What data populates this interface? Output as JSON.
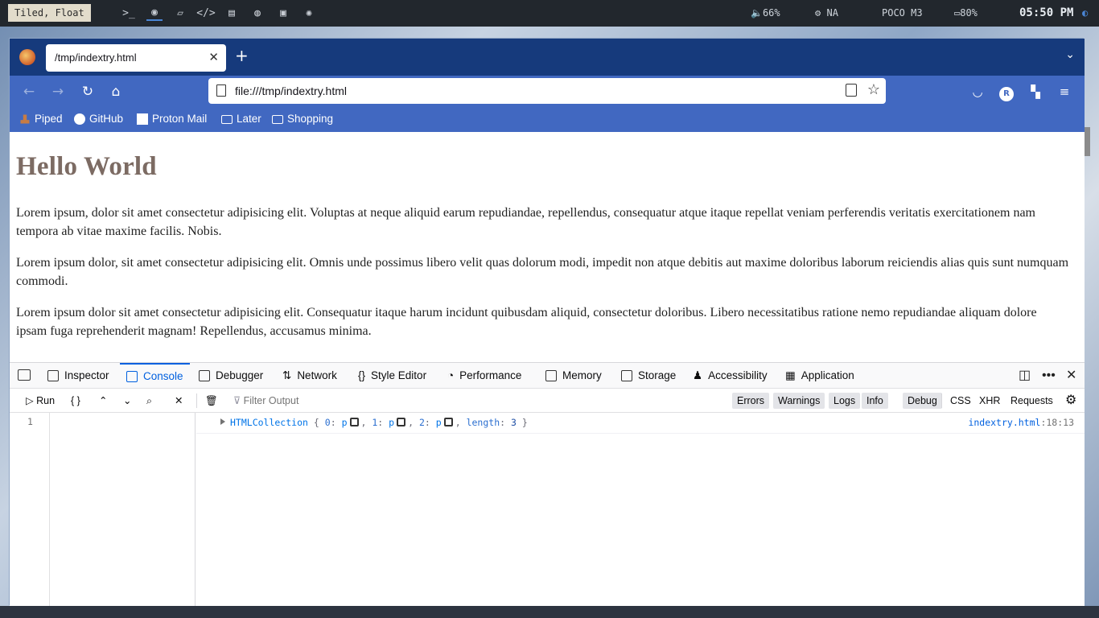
{
  "system_bar": {
    "layout_label": "Tiled, Float",
    "volume": "66%",
    "cpu": "NA",
    "device": "POCO M3",
    "battery": "80%",
    "clock": "05:50 PM",
    "icons": [
      "terminal-icon",
      "browser-icon",
      "files-icon",
      "code-icon",
      "notes-icon",
      "chat-icon",
      "media-icon",
      "settings-icon"
    ]
  },
  "browser": {
    "tab": {
      "title": "/tmp/indextry.html",
      "close": "✕"
    },
    "new_tab": "+",
    "url": "file:///tmp/indextry.html",
    "profile_initial": "R",
    "bookmarks": [
      "Piped",
      "GitHub",
      "Proton Mail",
      "Later",
      "Shopping"
    ]
  },
  "page": {
    "heading": "Hello World",
    "paragraphs": [
      "Lorem ipsum, dolor sit amet consectetur adipisicing elit. Voluptas at neque aliquid earum repudiandae, repellendus, consequatur atque itaque repellat veniam perferendis veritatis exercitationem nam tempora ab vitae maxime facilis. Nobis.",
      "Lorem ipsum dolor, sit amet consectetur adipisicing elit. Omnis unde possimus libero velit quas dolorum modi, impedit non atque debitis aut maxime doloribus laborum reiciendis alias quis sunt numquam commodi.",
      "Lorem ipsum dolor sit amet consectetur adipisicing elit. Consequatur itaque harum incidunt quibusdam aliquid, consectetur doloribus. Libero necessitatibus ratione nemo repudiandae aliquam dolore ipsam fuga reprehenderit magnam! Repellendus, accusamus minima."
    ]
  },
  "devtools": {
    "tabs": [
      "Inspector",
      "Console",
      "Debugger",
      "Network",
      "Style Editor",
      "Performance",
      "Memory",
      "Storage",
      "Accessibility",
      "Application"
    ],
    "active_tab": "Console",
    "toolbar": {
      "run": "Run",
      "pretty": "{ }",
      "filter_placeholder": "Filter Output",
      "levels": [
        "Errors",
        "Warnings",
        "Logs",
        "Info",
        "Debug"
      ],
      "requests": [
        "CSS",
        "XHR",
        "Requests"
      ]
    },
    "editor": {
      "line_number": "1"
    },
    "console_message": {
      "type": "HTMLCollection",
      "open": "{",
      "entries": [
        {
          "key": "0",
          "value": "p"
        },
        {
          "key": "1",
          "value": "p"
        },
        {
          "key": "2",
          "value": "p"
        }
      ],
      "length_key": "length",
      "length_value": "3",
      "close": "}",
      "location_file": "indextry.html",
      "location_pos": ":18:13"
    }
  }
}
